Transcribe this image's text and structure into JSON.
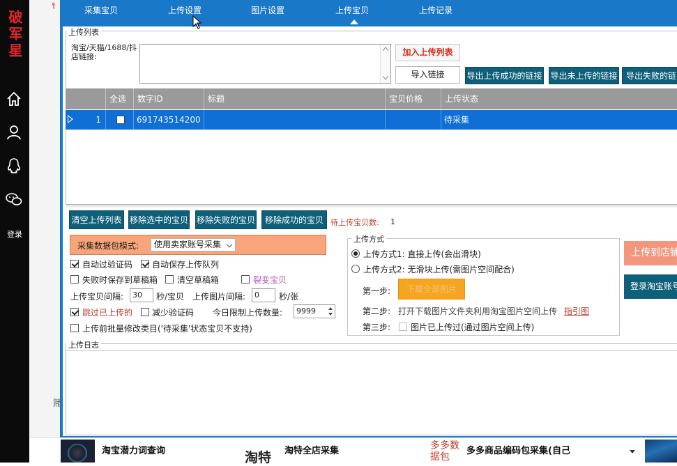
{
  "sidebar": {
    "brand": "破军星",
    "login_label": "登录",
    "icons": [
      "home-icon",
      "user-icon",
      "qq-icon",
      "wechat-icon"
    ]
  },
  "background": {
    "top_fragment": "钅",
    "side_fragment": "赌"
  },
  "tabs": [
    {
      "label": "采集宝贝",
      "active": false
    },
    {
      "label": "上传设置",
      "active": false
    },
    {
      "label": "图片设置",
      "active": false
    },
    {
      "label": "上传宝贝",
      "active": true
    },
    {
      "label": "上传记录",
      "active": false
    }
  ],
  "upload_list": {
    "group_title": "上传列表",
    "link_label": "淘宝/天猫/1688/抖店链接:",
    "link_value": "",
    "add_button": "加入上传列表",
    "import_button": "导入链接",
    "export_buttons": [
      "导出上传成功的链接",
      "导出未上传的链接",
      "导出失败的链接"
    ]
  },
  "grid": {
    "columns": [
      "全选",
      "数字ID",
      "标题",
      "宝贝价格",
      "上传状态"
    ],
    "rows": [
      {
        "index": "1",
        "checked": false,
        "id": "691743514200",
        "title": "",
        "price": "",
        "status": "待采集"
      }
    ]
  },
  "actions": {
    "buttons": [
      "清空上传列表",
      "移除选中的宝贝",
      "移除失败的宝贝",
      "移除成功的宝贝"
    ],
    "pending_label": "待上传宝贝数:",
    "pending_count": "1"
  },
  "settings": {
    "mode_label": "采集数据包模式:",
    "mode_value": "使用卖家账号采集",
    "auto_captcha": {
      "label": "自动过验证码",
      "checked": true
    },
    "auto_save_queue": {
      "label": "自动保存上传队列",
      "checked": true
    },
    "save_draft_on_fail": {
      "label": "失败时保存到草稿箱",
      "checked": false
    },
    "clear_drafts": {
      "label": "清空草稿箱",
      "checked": false
    },
    "fission": {
      "label": "裂变宝贝",
      "checked": false
    },
    "interval_label": "上传宝贝间隔:",
    "interval_value": "30",
    "interval_unit": "秒/宝贝",
    "img_interval_label": "上传图片间隔:",
    "img_interval_value": "0",
    "img_interval_unit": "秒/张",
    "skip_uploaded": {
      "label": "跳过已上传的",
      "checked": true
    },
    "reduce_captcha": {
      "label": "减少验证码",
      "checked": false
    },
    "daily_limit_label": "今日限制上传数量:",
    "daily_limit_value": "9999",
    "batch_category": {
      "label": "上传前批量修改类目('待采集'状态宝贝不支持)",
      "checked": false
    }
  },
  "upload_method": {
    "group_title": "上传方式",
    "option1": {
      "label": "上传方式1: 直接上传(会出滑块)",
      "selected": true
    },
    "option2": {
      "label": "上传方式2: 无滑块上传(需图片空间配合)",
      "selected": false
    },
    "step1_label": "第一步:",
    "step1_button": "下载全部图片",
    "step2_label": "第二步:",
    "step2_text": "打开下载图片文件夹利用淘宝图片空间上传",
    "guide_link": "指引图",
    "step3_label": "第三步:",
    "step3_check": {
      "label": "图片已上传过(通过图片空间上传)",
      "checked": false
    }
  },
  "side_buttons": {
    "upload_shop": "上传到店铺",
    "login_taobao": "登录淘宝账号"
  },
  "log": {
    "group_title": "上传日志",
    "content": ""
  },
  "bottom": {
    "item1": "淘宝潜力词查询",
    "logo_text": "淘特",
    "item2": "淘特全店采集",
    "duoduo": "多多数据包",
    "item3": "多多商品编码包采集(自己"
  },
  "colors": {
    "window_blue": "#1a78c9",
    "selected_row": "#0f6fd6",
    "teal_button": "#0e5f7a",
    "orange_box": "#f8a57b",
    "red_accent": "#d42a1e"
  }
}
